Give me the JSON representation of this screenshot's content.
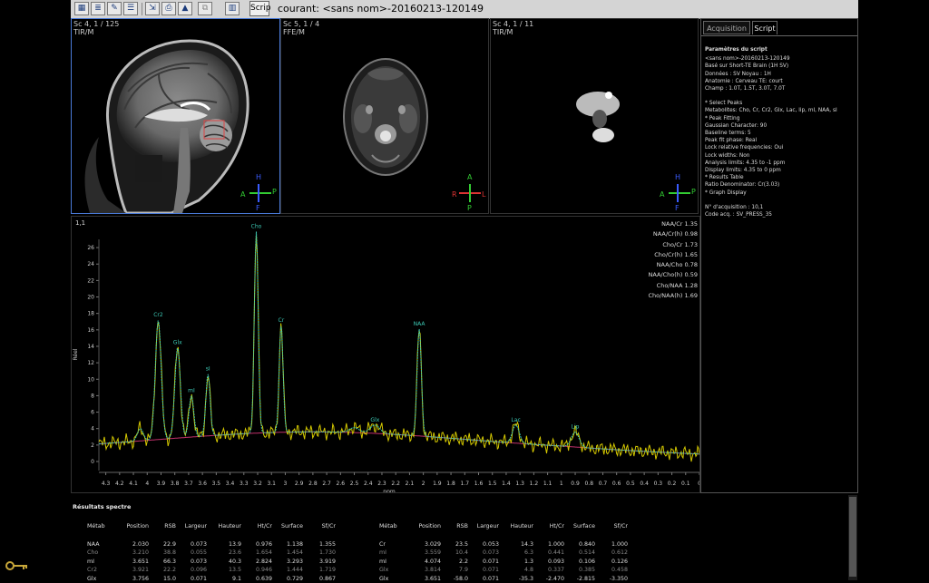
{
  "toolbar": {
    "script_label": "Scrip",
    "title": "courant: <sans nom>-20160213-120149"
  },
  "viewports": [
    {
      "label1": "Sc 4, 1 / 125",
      "label2": "TIR/M",
      "orient": {
        "top": "H",
        "left": "A",
        "right": "P",
        "bottom": "F"
      }
    },
    {
      "label1": "Sc 5, 1 / 4",
      "label2": "FFE/M",
      "orient": {
        "top": "A",
        "left": "R",
        "right": "L",
        "bottom": "P"
      }
    },
    {
      "label1": "Sc 4, 1 / 11",
      "label2": "TIR/M",
      "orient": {
        "top": "H",
        "left": "A",
        "right": "P",
        "bottom": "F"
      }
    }
  ],
  "spectrum": {
    "frame_label": "1,1",
    "ylabel": "Réel",
    "xlabel": "ppm",
    "yticks": [
      "0",
      "2",
      "4",
      "6",
      "8",
      "10",
      "12",
      "14",
      "16",
      "18",
      "20",
      "22",
      "24",
      "26"
    ],
    "xticks": [
      "4.3",
      "4.2",
      "4.1",
      "4",
      "3.9",
      "3.8",
      "3.7",
      "3.6",
      "3.5",
      "3.4",
      "3.3",
      "3.2",
      "3.1",
      "3",
      "2.9",
      "2.8",
      "2.7",
      "2.6",
      "2.5",
      "2.4",
      "2.3",
      "2.2",
      "2.1",
      "2",
      "1.9",
      "1.8",
      "1.7",
      "1.6",
      "1.5",
      "1.4",
      "1.3",
      "1.2",
      "1.1",
      "1",
      "0.9",
      "0.8",
      "0.7",
      "0.6",
      "0.5",
      "0.4",
      "0.3",
      "0.2",
      "0.1",
      "0"
    ],
    "peak_labels": [
      "Cr2",
      "Glx",
      "mI",
      "sI",
      "Cho",
      "Cr",
      "NAA",
      "Glx",
      "Lac",
      "Lip"
    ],
    "ratios": [
      {
        "name": "NAA/Cr",
        "value": "1.35"
      },
      {
        "name": "NAA/Cr(h)",
        "value": "0.98"
      },
      {
        "name": "Cho/Cr",
        "value": "1.73"
      },
      {
        "name": "Cho/Cr(h)",
        "value": "1.65"
      },
      {
        "name": "NAA/Cho",
        "value": "0.78"
      },
      {
        "name": "NAA/Cho(h)",
        "value": "0.59"
      },
      {
        "name": "Cho/NAA",
        "value": "1.28"
      },
      {
        "name": "Cho/NAA(h)",
        "value": "1.69"
      }
    ]
  },
  "right_panel": {
    "tabs": [
      "Acquisition",
      "Script"
    ],
    "heading": "Paramètres du script",
    "lines": [
      "<sans nom>-20160213-120149",
      "Basé sur Short-TE Brain (1H SV)",
      "Données : SV  Noyau : 1H",
      "Anatomie : Cerveau  TE: court",
      "Champ : 1.0T, 1.5T, 3.0T, 7.0T",
      "",
      "* Select Peaks",
      "    Metabolites: Cho, Cr, Cr2, Glx, Lac, lip, mI, NAA, sI",
      "* Peak Fitting",
      "    Gaussian Character: 90",
      "    Baseline terms: 5",
      "    Peak fit phase: Real",
      "    Lock relative frequencies: Oui",
      "    Lock widths: Non",
      "    Analysis limits: 4.35 to -1 ppm",
      "    Display limits: 4.35 to 0 ppm",
      "* Results Table",
      "    Ratio Denominator: Cr(3.03)",
      "* Graph Display",
      "",
      "N° d'acquisition : 10,1",
      "Code acq. : SV_PRESS_35"
    ]
  },
  "results": {
    "title": "Résultats spectre",
    "headers": [
      "Métab",
      "Position",
      "RSB",
      "Largeur",
      "Hauteur",
      "Ht/Cr",
      "Surface",
      "Sf/Cr"
    ],
    "left_rows": [
      [
        "NAA",
        "2.030",
        "22.9",
        "0.073",
        "13.9",
        "0.976",
        "1.138",
        "1.355"
      ],
      [
        "Cho",
        "3.210",
        "38.8",
        "0.055",
        "23.6",
        "1.654",
        "1.454",
        "1.730"
      ],
      [
        "mI",
        "3.651",
        "66.3",
        "0.073",
        "40.3",
        "2.824",
        "3.293",
        "3.919"
      ],
      [
        "Cr2",
        "3.921",
        "22.2",
        "0.096",
        "13.5",
        "0.946",
        "1.444",
        "1.719"
      ],
      [
        "Glx",
        "3.756",
        "15.0",
        "0.071",
        "9.1",
        "0.639",
        "0.729",
        "0.867"
      ]
    ],
    "right_rows": [
      [
        "Cr",
        "3.029",
        "23.5",
        "0.053",
        "14.3",
        "1.000",
        "0.840",
        "1.000"
      ],
      [
        "mI",
        "3.559",
        "10.4",
        "0.073",
        "6.3",
        "0.441",
        "0.514",
        "0.612"
      ],
      [
        "mI",
        "4.074",
        "2.2",
        "0.071",
        "1.3",
        "0.093",
        "0.106",
        "0.126"
      ],
      [
        "Glx",
        "3.814",
        "7.9",
        "0.071",
        "4.8",
        "0.337",
        "0.385",
        "0.458"
      ],
      [
        "Glx",
        "3.651",
        "-58.0",
        "0.071",
        "-35.3",
        "-2.470",
        "-2.815",
        "-3.350"
      ]
    ]
  },
  "colors": {
    "data_line": "#d4c800",
    "fit_line": "#3cc8b4",
    "baseline": "#c0306a",
    "accent": "#4a7ad8"
  }
}
